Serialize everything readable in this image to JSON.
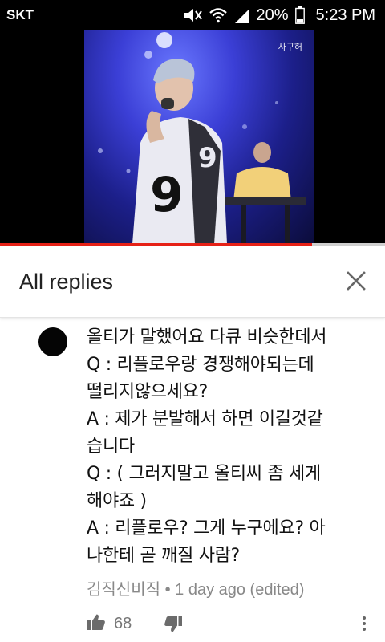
{
  "status_bar": {
    "carrier": "SKT",
    "battery": "20%",
    "time": "5:23 PM",
    "icons": [
      "mute-icon",
      "wifi-icon",
      "signal-icon",
      "battery-icon"
    ]
  },
  "video": {
    "watermark": "사구허",
    "progress": 0.81,
    "progress_color": "#e62117"
  },
  "replies": {
    "title": "All replies",
    "close_icon": "close-icon"
  },
  "comment": {
    "text": "올티가 말했어요 다큐 비슷한데서\nQ : 리플로우랑 경쟁해야되는데\n떨리지않으세요?\nA : 제가 분발해서 하면 이길것같\n습니다\nQ : ( 그러지말고 올티씨 좀 세게\n해야죠 )\nA : 리플로우? 그게 누구에요? 아\n나한테 곧 깨질 사람?",
    "author": "김직신비직",
    "separator": "•",
    "time": "1 day ago (edited)",
    "likes": "68"
  }
}
